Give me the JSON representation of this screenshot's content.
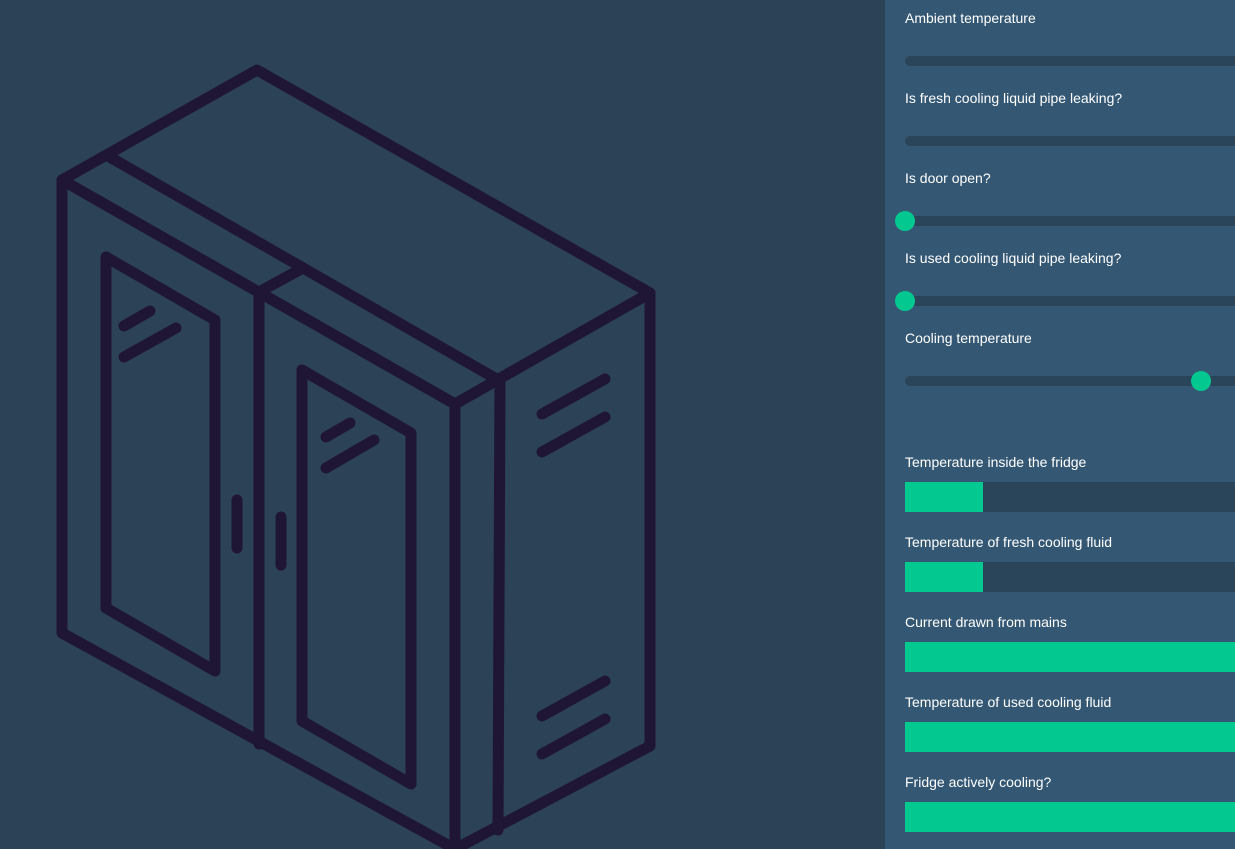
{
  "controls": [
    {
      "label": "Ambient temperature",
      "value": null
    },
    {
      "label": "Is fresh cooling liquid pipe leaking?",
      "value": null
    },
    {
      "label": "Is door open?",
      "value": 0
    },
    {
      "label": "Is used cooling liquid pipe leaking?",
      "value": 0
    },
    {
      "label": "Cooling temperature",
      "value": 0.87
    }
  ],
  "indicators": [
    {
      "label": "Temperature inside the fridge",
      "fill": 0.23
    },
    {
      "label": "Temperature of fresh cooling fluid",
      "fill": 0.23
    },
    {
      "label": "Current drawn from mains",
      "fill": 1.0
    },
    {
      "label": "Temperature of used cooling fluid",
      "fill": 1.0
    },
    {
      "label": "Fridge actively cooling?",
      "fill": 1.0
    }
  ],
  "colors": {
    "accent": "#03c890",
    "panel": "#345773",
    "track": "#2a4459",
    "illustration_bg": "#2c4256",
    "outline": "#1f1534"
  },
  "illustration": {
    "icon": "double-door-fridge-icon"
  }
}
